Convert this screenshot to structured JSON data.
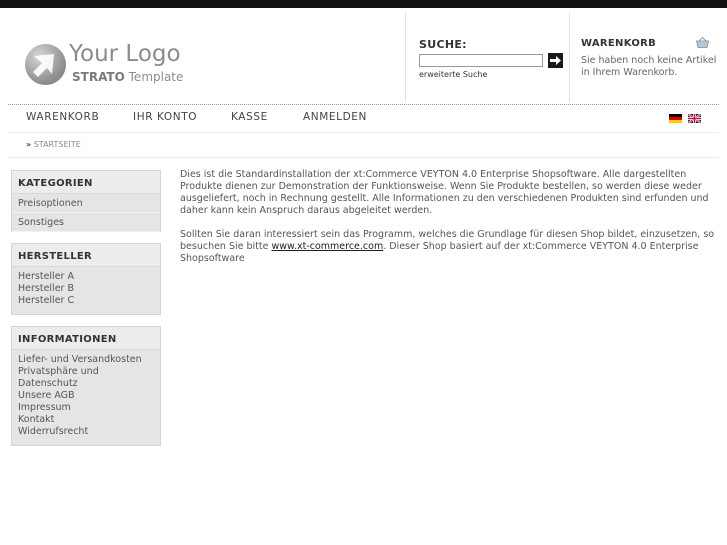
{
  "logo": {
    "title": "Your Logo",
    "sub_bold": "STRATO",
    "sub_rest": "Template"
  },
  "search": {
    "title": "SUCHE:",
    "value": "",
    "placeholder": "",
    "button_icon": "arrow-right-icon",
    "advanced_link": "erweiterte Suche"
  },
  "cart": {
    "title": "WARENKORB",
    "icon": "basket-icon",
    "text": "Sie haben noch keine Artikel in Ihrem Warenkorb."
  },
  "nav": {
    "items": [
      "WARENKORB",
      "IHR KONTO",
      "KASSE",
      "ANMELDEN"
    ],
    "flags": [
      "german-flag-icon",
      "uk-flag-icon"
    ]
  },
  "breadcrumb": {
    "arrow": "»",
    "label": "STARTSEITE"
  },
  "sidebar": {
    "categories": {
      "title": "KATEGORIEN",
      "items": [
        "Preisoptionen",
        "Sonstiges"
      ]
    },
    "manufacturers": {
      "title": "HERSTELLER",
      "items": [
        "Hersteller A",
        "Hersteller B",
        "Hersteller C"
      ]
    },
    "information": {
      "title": "INFORMATIONEN",
      "items": [
        "Liefer- und Versandkosten",
        "Privatsphäre und",
        "Datenschutz",
        "Unsere AGB",
        "Impressum",
        "Kontakt",
        "Widerrufsrecht"
      ]
    }
  },
  "content": {
    "paragraph1": "Dies ist die Standardinstallation der xt:Commerce VEYTON 4.0 Enterprise Shopsoftware. Alle dargestellten Produkte dienen zur Demonstration der Funktionsweise. Wenn Sie Produkte bestellen, so werden diese weder ausgeliefert, noch in Rechnung gestellt. Alle Informationen zu den verschiedenen Produkten sind erfunden und daher kann kein Anspruch daraus abgeleitet werden.",
    "paragraph2_before": "Sollten Sie daran interessiert sein das Programm, welches die Grundlage für diesen Shop bildet, einzusetzen, so besuchen Sie bitte ",
    "paragraph2_link": "www.xt-commerce.com",
    "paragraph2_after": ". Dieser Shop basiert auf der xt:Commerce VEYTON 4.0 Enterprise Shopsoftware"
  },
  "colors": {
    "topbar": "#111111",
    "box_bg": "#e5e5e5",
    "text": "#555555"
  }
}
